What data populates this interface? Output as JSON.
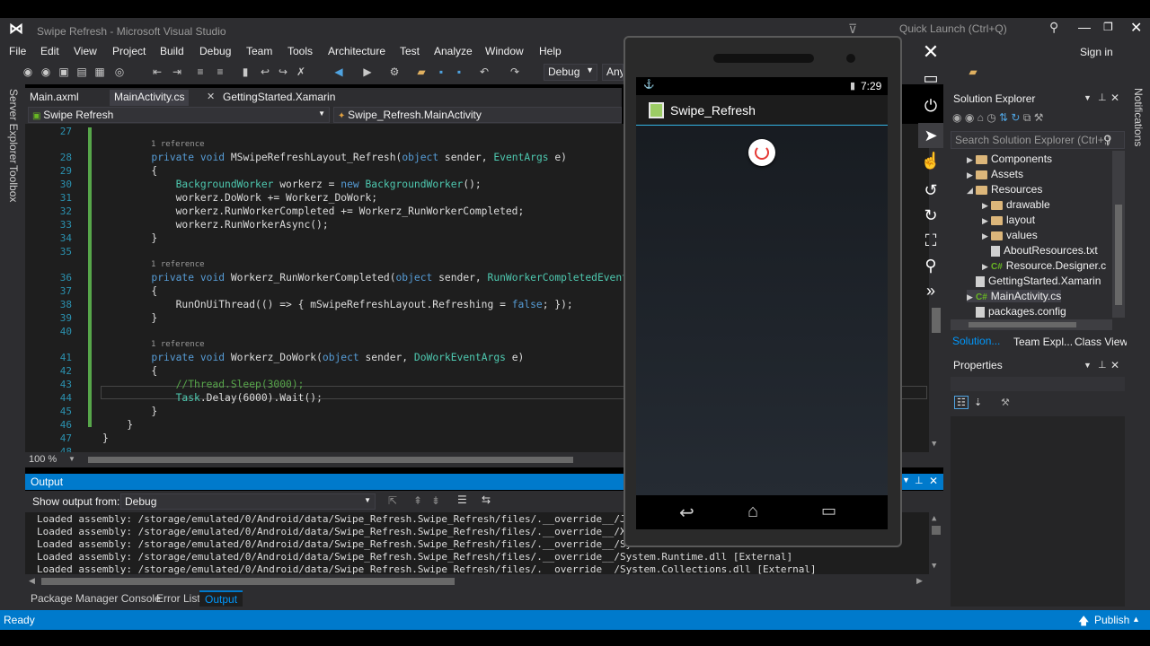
{
  "window": {
    "title": "Swipe Refresh - Microsoft Visual Studio",
    "quick_launch": "Quick Launch (Ctrl+Q)",
    "sign_in": "Sign in"
  },
  "menu": [
    "File",
    "Edit",
    "View",
    "Project",
    "Build",
    "Debug",
    "Team",
    "Tools",
    "Architecture",
    "Test",
    "Analyze",
    "Window",
    "Help"
  ],
  "toolbar": {
    "config": "Debug",
    "platform": "Any"
  },
  "left_strip": [
    "Server Explorer",
    "Toolbox"
  ],
  "tabs": [
    {
      "label": "Main.axml"
    },
    {
      "label": "MainActivity.cs"
    },
    {
      "label": "GettingStarted.Xamarin"
    }
  ],
  "nav": {
    "project": "Swipe Refresh",
    "class": "Swipe_Refresh.MainActivity"
  },
  "code": {
    "lines": [
      {
        "n": "27",
        "text": ""
      },
      {
        "n": "28",
        "text": "        private void MSwipeRefreshLayout_Refresh(object sender, EventArgs e)",
        "ref": "1 reference"
      },
      {
        "n": "29",
        "text": "        {"
      },
      {
        "n": "30",
        "text": "            BackgroundWorker workerz = new BackgroundWorker();"
      },
      {
        "n": "31",
        "text": "            workerz.DoWork += Workerz_DoWork;"
      },
      {
        "n": "32",
        "text": "            workerz.RunWorkerCompleted += Workerz_RunWorkerCompleted;"
      },
      {
        "n": "33",
        "text": "            workerz.RunWorkerAsync();"
      },
      {
        "n": "34",
        "text": "        }"
      },
      {
        "n": "35",
        "text": ""
      },
      {
        "n": "36",
        "text": "        private void Workerz_RunWorkerCompleted(object sender, RunWorkerCompletedEventAr",
        "ref": "1 reference"
      },
      {
        "n": "37",
        "text": "        {"
      },
      {
        "n": "38",
        "text": "            RunOnUiThread(() => { mSwipeRefreshLayout.Refreshing = false; });"
      },
      {
        "n": "39",
        "text": "        }"
      },
      {
        "n": "40",
        "text": ""
      },
      {
        "n": "41",
        "text": "        private void Workerz_DoWork(object sender, DoWorkEventArgs e)",
        "ref": "1 reference"
      },
      {
        "n": "42",
        "text": "        {"
      },
      {
        "n": "43",
        "text": "            //Thread.Sleep(3000);"
      },
      {
        "n": "44",
        "text": "            Task.Delay(6000).Wait();"
      },
      {
        "n": "45",
        "text": "        }"
      },
      {
        "n": "46",
        "text": "    }"
      },
      {
        "n": "47",
        "text": "}"
      },
      {
        "n": "48",
        "text": ""
      }
    ]
  },
  "zoom": "100 %",
  "output": {
    "title": "Output",
    "show_from_label": "Show output from:",
    "source": "Debug",
    "lines": [
      "Loaded assembly: /storage/emulated/0/Android/data/Swipe_Refresh.Swipe_Refresh/files/.__override__/J",
      "Loaded assembly: /storage/emulated/0/Android/data/Swipe_Refresh.Swipe_Refresh/files/.__override__/X",
      "Loaded assembly: /storage/emulated/0/Android/data/Swipe_Refresh.Swipe_Refresh/files/.__override__/Sy",
      "Loaded assembly: /storage/emulated/0/Android/data/Swipe_Refresh.Swipe_Refresh/files/.__override__/System.Runtime.dll [External]",
      "Loaded assembly: /storage/emulated/0/Android/data/Swipe_Refresh.Swipe_Refresh/files/.__override__/System.Collections.dll [External]"
    ]
  },
  "bottom_tabs": [
    "Package Manager Console",
    "Error List",
    "Output"
  ],
  "status": {
    "left": "Ready",
    "right": "Publish"
  },
  "solution_explorer": {
    "title": "Solution Explorer",
    "search": "Search Solution Explorer (Ctrl+;)",
    "items": [
      {
        "label": "Components",
        "kind": "folder",
        "indent": 1,
        "arrow": "▶"
      },
      {
        "label": "Assets",
        "kind": "folder",
        "indent": 1,
        "arrow": "▶"
      },
      {
        "label": "Resources",
        "kind": "folder",
        "indent": 1,
        "arrow": "◢"
      },
      {
        "label": "drawable",
        "kind": "folder",
        "indent": 2,
        "arrow": "▶"
      },
      {
        "label": "layout",
        "kind": "folder",
        "indent": 2,
        "arrow": "▶"
      },
      {
        "label": "values",
        "kind": "folder",
        "indent": 2,
        "arrow": "▶"
      },
      {
        "label": "AboutResources.txt",
        "kind": "file",
        "indent": 2,
        "arrow": ""
      },
      {
        "label": "Resource.Designer.c",
        "kind": "cs",
        "indent": 2,
        "arrow": "▶"
      },
      {
        "label": "GettingStarted.Xamarin",
        "kind": "file",
        "indent": 1,
        "arrow": ""
      },
      {
        "label": "MainActivity.cs",
        "kind": "cs",
        "indent": 1,
        "arrow": "▶"
      },
      {
        "label": "packages.config",
        "kind": "file",
        "indent": 1,
        "arrow": ""
      }
    ],
    "tabs": [
      "Solution...",
      "Team Expl...",
      "Class View"
    ]
  },
  "properties": {
    "title": "Properties"
  },
  "right_strip": "Notifications",
  "emulator": {
    "time": "7:29",
    "app_title": "Swipe_Refresh",
    "spinner_color": "#e53935",
    "accent": "#33b5e5"
  },
  "colors": {
    "accent": "#007acc",
    "editor_bg": "#1e1e1e",
    "chrome": "#2d2d30"
  }
}
